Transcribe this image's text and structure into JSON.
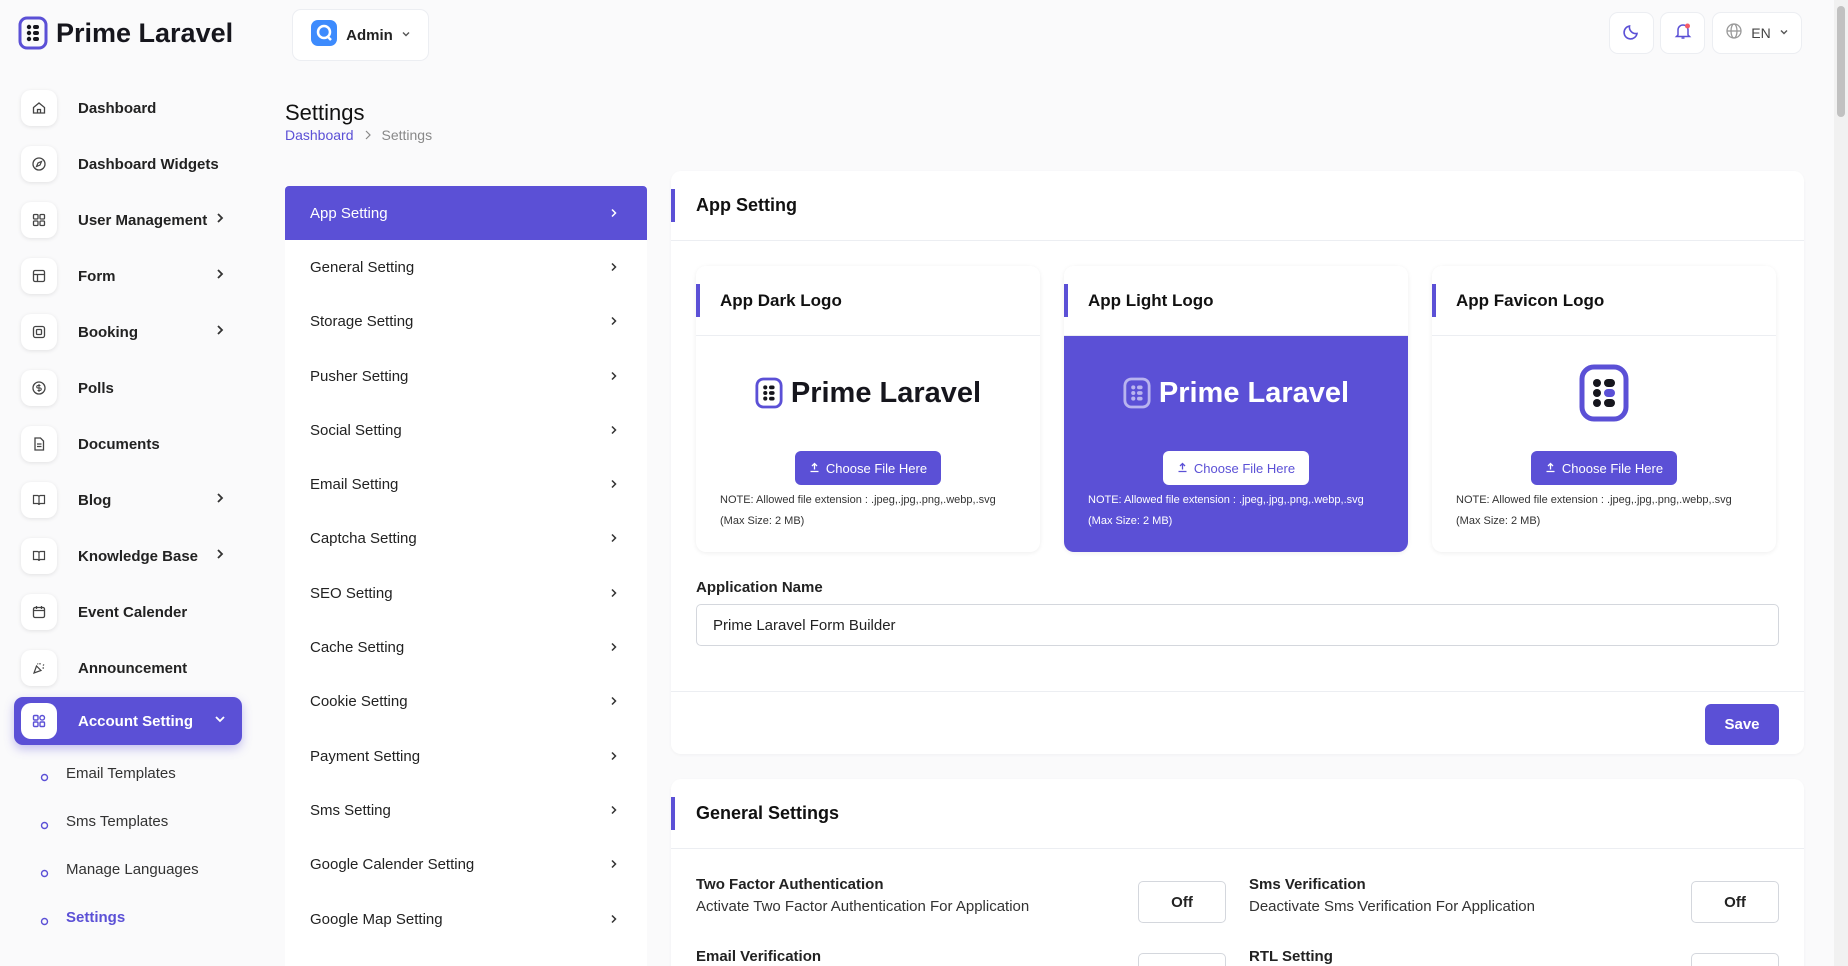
{
  "brand": {
    "name": "Prime Laravel"
  },
  "header": {
    "role": "Admin",
    "language": "EN"
  },
  "sidebar": {
    "items": [
      {
        "label": "Dashboard",
        "icon": "home-icon",
        "has_children": false
      },
      {
        "label": "Dashboard Widgets",
        "icon": "compass-icon",
        "has_children": false
      },
      {
        "label": "User Management",
        "icon": "grid-icon",
        "has_children": true
      },
      {
        "label": "Form",
        "icon": "table-icon",
        "has_children": true
      },
      {
        "label": "Booking",
        "icon": "square-icon",
        "has_children": true
      },
      {
        "label": "Polls",
        "icon": "coin-icon",
        "has_children": false
      },
      {
        "label": "Documents",
        "icon": "file-icon",
        "has_children": false
      },
      {
        "label": "Blog",
        "icon": "book-icon",
        "has_children": true
      },
      {
        "label": "Knowledge Base",
        "icon": "book-icon",
        "has_children": true
      },
      {
        "label": "Event Calender",
        "icon": "calendar-icon",
        "has_children": false
      },
      {
        "label": "Announcement",
        "icon": "confetti-icon",
        "has_children": false
      },
      {
        "label": "Account Setting",
        "icon": "apps-icon",
        "has_children": true,
        "active": true
      }
    ],
    "sub_items": [
      {
        "label": "Email Templates"
      },
      {
        "label": "Sms Templates"
      },
      {
        "label": "Manage Languages"
      },
      {
        "label": "Settings",
        "active": true
      }
    ]
  },
  "page": {
    "title": "Settings",
    "breadcrumb": [
      "Dashboard",
      "Settings"
    ]
  },
  "settings_menu": [
    {
      "label": "App Setting",
      "active": true
    },
    {
      "label": "General Setting"
    },
    {
      "label": "Storage Setting"
    },
    {
      "label": "Pusher Setting"
    },
    {
      "label": "Social Setting"
    },
    {
      "label": "Email Setting"
    },
    {
      "label": "Captcha Setting"
    },
    {
      "label": "SEO Setting"
    },
    {
      "label": "Cache Setting"
    },
    {
      "label": "Cookie Setting"
    },
    {
      "label": "Payment Setting"
    },
    {
      "label": "Sms Setting"
    },
    {
      "label": "Google Calender Setting"
    },
    {
      "label": "Google Map Setting"
    }
  ],
  "app_setting": {
    "title": "App Setting",
    "logos": [
      {
        "title": "App Dark Logo",
        "logo_text": "Prime Laravel",
        "button": "Choose File Here",
        "note": "NOTE: Allowed file extension : .jpeg,.jpg,.png,.webp,.svg (Max Size: 2 MB)"
      },
      {
        "title": "App Light Logo",
        "logo_text": "Prime Laravel",
        "button": "Choose File Here",
        "note": "NOTE: Allowed file extension : .jpeg,.jpg,.png,.webp,.svg (Max Size: 2 MB)"
      },
      {
        "title": "App Favicon Logo",
        "button": "Choose File Here",
        "note": "NOTE: Allowed file extension : .jpeg,.jpg,.png,.webp,.svg (Max Size: 2 MB)"
      }
    ],
    "app_name_label": "Application Name",
    "app_name_value": "Prime Laravel Form Builder",
    "save": "Save"
  },
  "general_settings": {
    "title": "General Settings",
    "rows": [
      {
        "title": "Two Factor Authentication",
        "desc": "Activate Two Factor Authentication For Application",
        "value": "Off"
      },
      {
        "title": "Sms Verification",
        "desc": "Deactivate Sms Verification For Application",
        "value": "Off"
      },
      {
        "title": "Email Verification"
      },
      {
        "title": "RTL Setting"
      }
    ]
  },
  "colors": {
    "accent": "#5b50d6",
    "background": "#fafafb"
  }
}
